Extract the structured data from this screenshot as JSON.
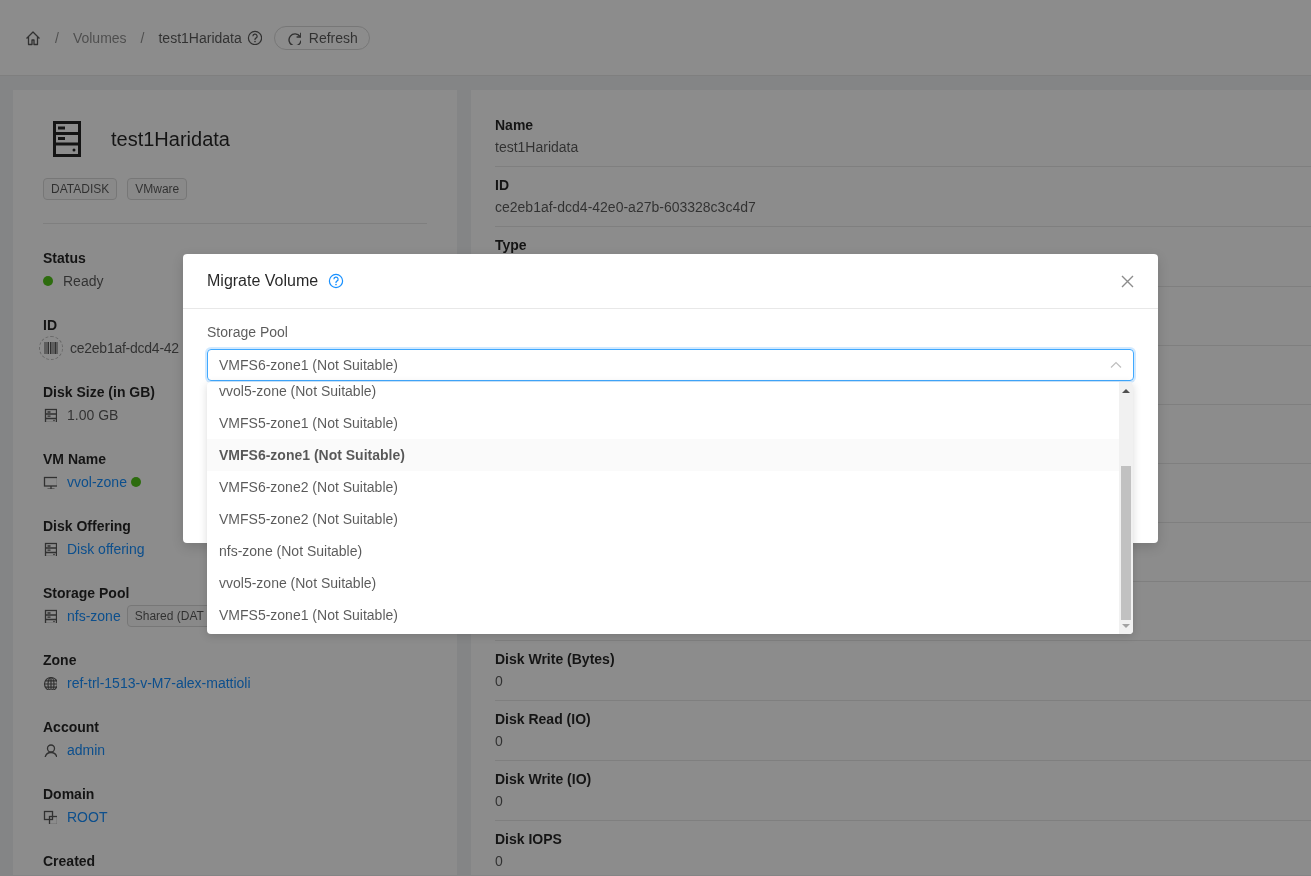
{
  "breadcrumb": {
    "items": [
      {
        "label": "Volumes",
        "kind": "link"
      },
      {
        "label": "test1Haridata",
        "kind": "current"
      }
    ],
    "separator": "/",
    "refresh": "Refresh"
  },
  "volume": {
    "title": "test1Haridata",
    "tags": [
      "DATADISK",
      "VMware"
    ],
    "fields": [
      {
        "kind": "status",
        "label": "Status",
        "value": "Ready",
        "color": "#2d6c0e"
      },
      {
        "kind": "id",
        "label": "ID",
        "value": "ce2eb1af-dcd4-42"
      },
      {
        "kind": "size",
        "label": "Disk Size (in GB)",
        "value": "1.00 GB"
      },
      {
        "kind": "vm",
        "label": "VM Name",
        "value": "vvol-zone",
        "color": "#2d6c0e"
      },
      {
        "kind": "offering",
        "label": "Disk Offering",
        "value": "Disk offering"
      },
      {
        "kind": "pool",
        "label": "Storage Pool",
        "value": "nfs-zone",
        "tag": "Shared (DAT"
      },
      {
        "kind": "zone",
        "label": "Zone",
        "value": "ref-trl-1513-v-M7-alex-mattioli"
      },
      {
        "kind": "account",
        "label": "Account",
        "value": "admin"
      },
      {
        "kind": "domain",
        "label": "Domain",
        "value": "ROOT"
      },
      {
        "kind": "heading",
        "label": "Created"
      }
    ]
  },
  "details": {
    "top": [
      {
        "label": "Name",
        "value": "test1Haridata"
      },
      {
        "label": "ID",
        "value": "ce2eb1af-dcd4-42e0-a27b-603328c3c4d7"
      },
      {
        "label": "Type"
      }
    ],
    "bottom": [
      {
        "label": "Disk Write (Bytes)",
        "value": "0"
      },
      {
        "label": "Disk Read (IO)",
        "value": "0"
      },
      {
        "label": "Disk Write (IO)",
        "value": "0"
      },
      {
        "label": "Disk IOPS",
        "value": "0"
      }
    ]
  },
  "dialog": {
    "title": "Migrate Volume",
    "field_label": "Storage Pool",
    "value": "VMFS6-zone1 (Not Suitable)",
    "options": [
      {
        "label": "vvol5-zone (Not Suitable)",
        "selected": false
      },
      {
        "label": "VMFS5-zone1 (Not Suitable)",
        "selected": false
      },
      {
        "label": "VMFS6-zone1 (Not Suitable)",
        "selected": true
      },
      {
        "label": "VMFS6-zone2 (Not Suitable)",
        "selected": false
      },
      {
        "label": "VMFS5-zone2 (Not Suitable)",
        "selected": false
      },
      {
        "label": "nfs-zone (Not Suitable)",
        "selected": false
      },
      {
        "label": "vvol5-zone (Not Suitable)",
        "selected": false
      },
      {
        "label": "VMFS5-zone1 (Not Suitable)",
        "selected": false
      }
    ]
  }
}
